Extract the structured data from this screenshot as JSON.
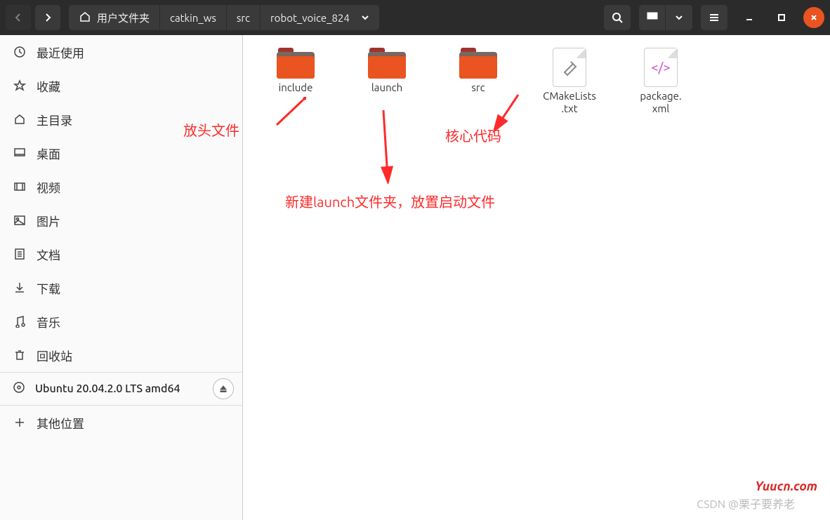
{
  "pathbar": {
    "home_label": "用户文件夹",
    "segments": [
      "catkin_ws",
      "src",
      "robot_voice_824"
    ]
  },
  "sidebar": {
    "items": [
      {
        "icon": "clock",
        "label": "最近使用"
      },
      {
        "icon": "star",
        "label": "收藏"
      },
      {
        "icon": "home",
        "label": "主目录"
      },
      {
        "icon": "desktop",
        "label": "桌面"
      },
      {
        "icon": "video",
        "label": "视频"
      },
      {
        "icon": "image",
        "label": "图片"
      },
      {
        "icon": "doc",
        "label": "文档"
      },
      {
        "icon": "download",
        "label": "下载"
      },
      {
        "icon": "music",
        "label": "音乐"
      },
      {
        "icon": "trash",
        "label": "回收站"
      }
    ],
    "disk_label": "Ubuntu 20.04.2.0 LTS amd64",
    "other_label": "其他位置"
  },
  "files": [
    {
      "type": "folder",
      "name": "include"
    },
    {
      "type": "folder",
      "name": "launch"
    },
    {
      "type": "folder",
      "name": "src"
    },
    {
      "type": "build",
      "name": "CMakeLists.txt"
    },
    {
      "type": "code",
      "name": "package.xml"
    }
  ],
  "annotations": {
    "a1": "放头文件",
    "a2": "新建launch文件夹，放置启动文件",
    "a3": "核心代码"
  },
  "watermark1": "Yuucn.com",
  "watermark2": "CSDN @栗子要养老"
}
